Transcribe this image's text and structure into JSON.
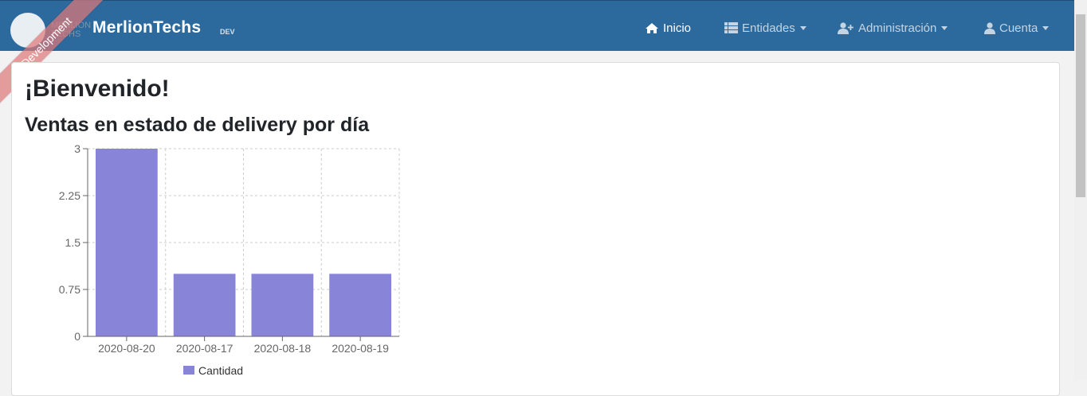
{
  "navbar": {
    "logo_text": "MERLION TECHS",
    "brand": "MerlionTechs",
    "env": "DEV",
    "ribbon": "Development",
    "items": [
      {
        "label": "Inicio",
        "icon": "home-icon"
      },
      {
        "label": "Entidades",
        "icon": "table-icon"
      },
      {
        "label": "Administración",
        "icon": "user-plus-icon"
      },
      {
        "label": "Cuenta",
        "icon": "user-icon"
      }
    ]
  },
  "page": {
    "welcome": "¡Bienvenido!",
    "subtitle": "Ventas en estado de delivery por día"
  },
  "colors": {
    "navbar": "#2c6a9e",
    "bar": "#8884d8"
  },
  "chart_data": {
    "type": "bar",
    "categories": [
      "2020-08-20",
      "2020-08-17",
      "2020-08-18",
      "2020-08-19"
    ],
    "series": [
      {
        "name": "Cantidad",
        "values": [
          3,
          1,
          1,
          1
        ]
      }
    ],
    "yticks": [
      "0",
      "0.75",
      "1.5",
      "2.25",
      "3"
    ],
    "ylim": [
      0,
      3
    ],
    "grid": true,
    "legend": "bottom"
  }
}
